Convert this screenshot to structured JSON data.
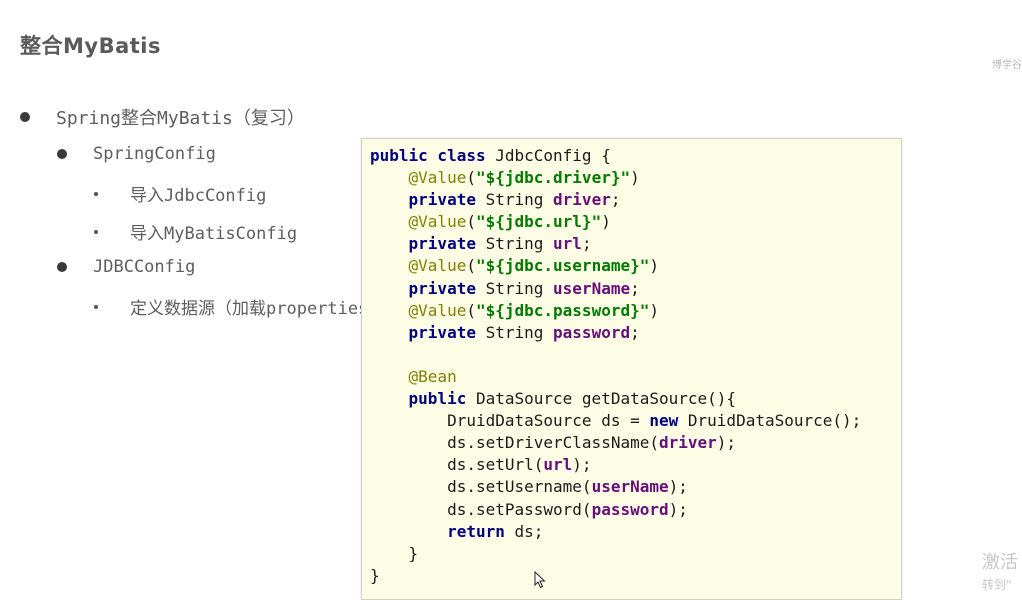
{
  "slide": {
    "title": "整合MyBatis",
    "watermark_top": "博学谷",
    "watermark_bottom_1": "激活",
    "watermark_bottom_2": "转到\""
  },
  "bullets": {
    "level1": "Spring整合MyBatis（复习）",
    "springconfig": "SpringConfig",
    "import_jdbc": "导入JdbcConfig",
    "import_mybatis": "导入MyBatisConfig",
    "jdbcconfig": "JDBCConfig",
    "define_datasource": "定义数据源（加载properties"
  },
  "code": {
    "lines": [
      [
        {
          "t": "public class",
          "c": "kw"
        },
        {
          "t": " JdbcConfig {"
        }
      ],
      [
        {
          "t": "    "
        },
        {
          "t": "@Value",
          "c": "ann"
        },
        {
          "t": "("
        },
        {
          "t": "\"${jdbc.driver}\"",
          "c": "str"
        },
        {
          "t": ")"
        }
      ],
      [
        {
          "t": "    "
        },
        {
          "t": "private",
          "c": "kw"
        },
        {
          "t": " String "
        },
        {
          "t": "driver",
          "c": "fld"
        },
        {
          "t": ";"
        }
      ],
      [
        {
          "t": "    "
        },
        {
          "t": "@Value",
          "c": "ann"
        },
        {
          "t": "("
        },
        {
          "t": "\"${jdbc.url}\"",
          "c": "str"
        },
        {
          "t": ")"
        }
      ],
      [
        {
          "t": "    "
        },
        {
          "t": "private",
          "c": "kw"
        },
        {
          "t": " String "
        },
        {
          "t": "url",
          "c": "fld"
        },
        {
          "t": ";"
        }
      ],
      [
        {
          "t": "    "
        },
        {
          "t": "@Value",
          "c": "ann"
        },
        {
          "t": "("
        },
        {
          "t": "\"${jdbc.username}\"",
          "c": "str"
        },
        {
          "t": ")"
        }
      ],
      [
        {
          "t": "    "
        },
        {
          "t": "private",
          "c": "kw"
        },
        {
          "t": " String "
        },
        {
          "t": "userName",
          "c": "fld"
        },
        {
          "t": ";"
        }
      ],
      [
        {
          "t": "    "
        },
        {
          "t": "@Value",
          "c": "ann"
        },
        {
          "t": "("
        },
        {
          "t": "\"${jdbc.password}\"",
          "c": "str"
        },
        {
          "t": ")"
        }
      ],
      [
        {
          "t": "    "
        },
        {
          "t": "private",
          "c": "kw"
        },
        {
          "t": " String "
        },
        {
          "t": "password",
          "c": "fld"
        },
        {
          "t": ";"
        }
      ],
      [
        {
          "t": ""
        }
      ],
      [
        {
          "t": "    "
        },
        {
          "t": "@Bean",
          "c": "ann"
        }
      ],
      [
        {
          "t": "    "
        },
        {
          "t": "public",
          "c": "kw"
        },
        {
          "t": " DataSource getDataSource(){"
        }
      ],
      [
        {
          "t": "        DruidDataSource ds = "
        },
        {
          "t": "new",
          "c": "kw"
        },
        {
          "t": " DruidDataSource();"
        }
      ],
      [
        {
          "t": "        ds.setDriverClassName("
        },
        {
          "t": "driver",
          "c": "fld"
        },
        {
          "t": ");"
        }
      ],
      [
        {
          "t": "        ds.setUrl("
        },
        {
          "t": "url",
          "c": "fld"
        },
        {
          "t": ");"
        }
      ],
      [
        {
          "t": "        ds.setUsername("
        },
        {
          "t": "userName",
          "c": "fld"
        },
        {
          "t": ");"
        }
      ],
      [
        {
          "t": "        ds.setPassword("
        },
        {
          "t": "password",
          "c": "fld"
        },
        {
          "t": ");"
        }
      ],
      [
        {
          "t": "        "
        },
        {
          "t": "return",
          "c": "kw"
        },
        {
          "t": " ds;"
        }
      ],
      [
        {
          "t": "    }"
        }
      ],
      [
        {
          "t": "}"
        }
      ]
    ]
  },
  "colors": {
    "keyword": "#000080",
    "annotation": "#808000",
    "string": "#007a00",
    "field": "#660e7a",
    "panel_bg": "#fdfde6"
  },
  "icons": {
    "cursor": "mouse-pointer-icon"
  }
}
